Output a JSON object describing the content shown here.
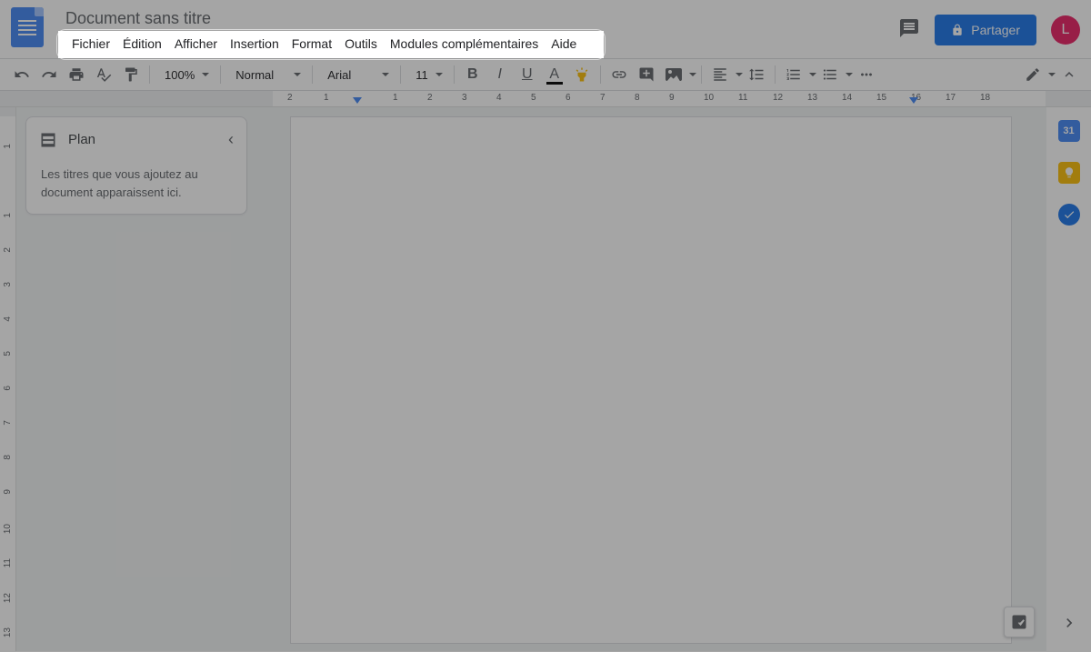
{
  "header": {
    "doc_title": "Document sans titre",
    "share_label": "Partager",
    "avatar_initial": "L"
  },
  "menu": {
    "items": [
      "Fichier",
      "Édition",
      "Afficher",
      "Insertion",
      "Format",
      "Outils",
      "Modules complémentaires",
      "Aide"
    ]
  },
  "toolbar": {
    "zoom": "100%",
    "style": "Normal",
    "font": "Arial",
    "size": "11"
  },
  "outline": {
    "title": "Plan",
    "empty_text": "Les titres que vous ajoutez au document apparaissent ici."
  },
  "ruler_h": [
    "2",
    "1",
    "1",
    "2",
    "3",
    "4",
    "5",
    "6",
    "7",
    "8",
    "9",
    "10",
    "11",
    "12",
    "13",
    "14",
    "15",
    "16",
    "17",
    "18"
  ],
  "ruler_v": [
    "1",
    "1",
    "2",
    "3",
    "4",
    "5",
    "6",
    "7",
    "8",
    "9",
    "10",
    "11",
    "12",
    "13"
  ],
  "right_rail": {
    "calendar": "31"
  }
}
